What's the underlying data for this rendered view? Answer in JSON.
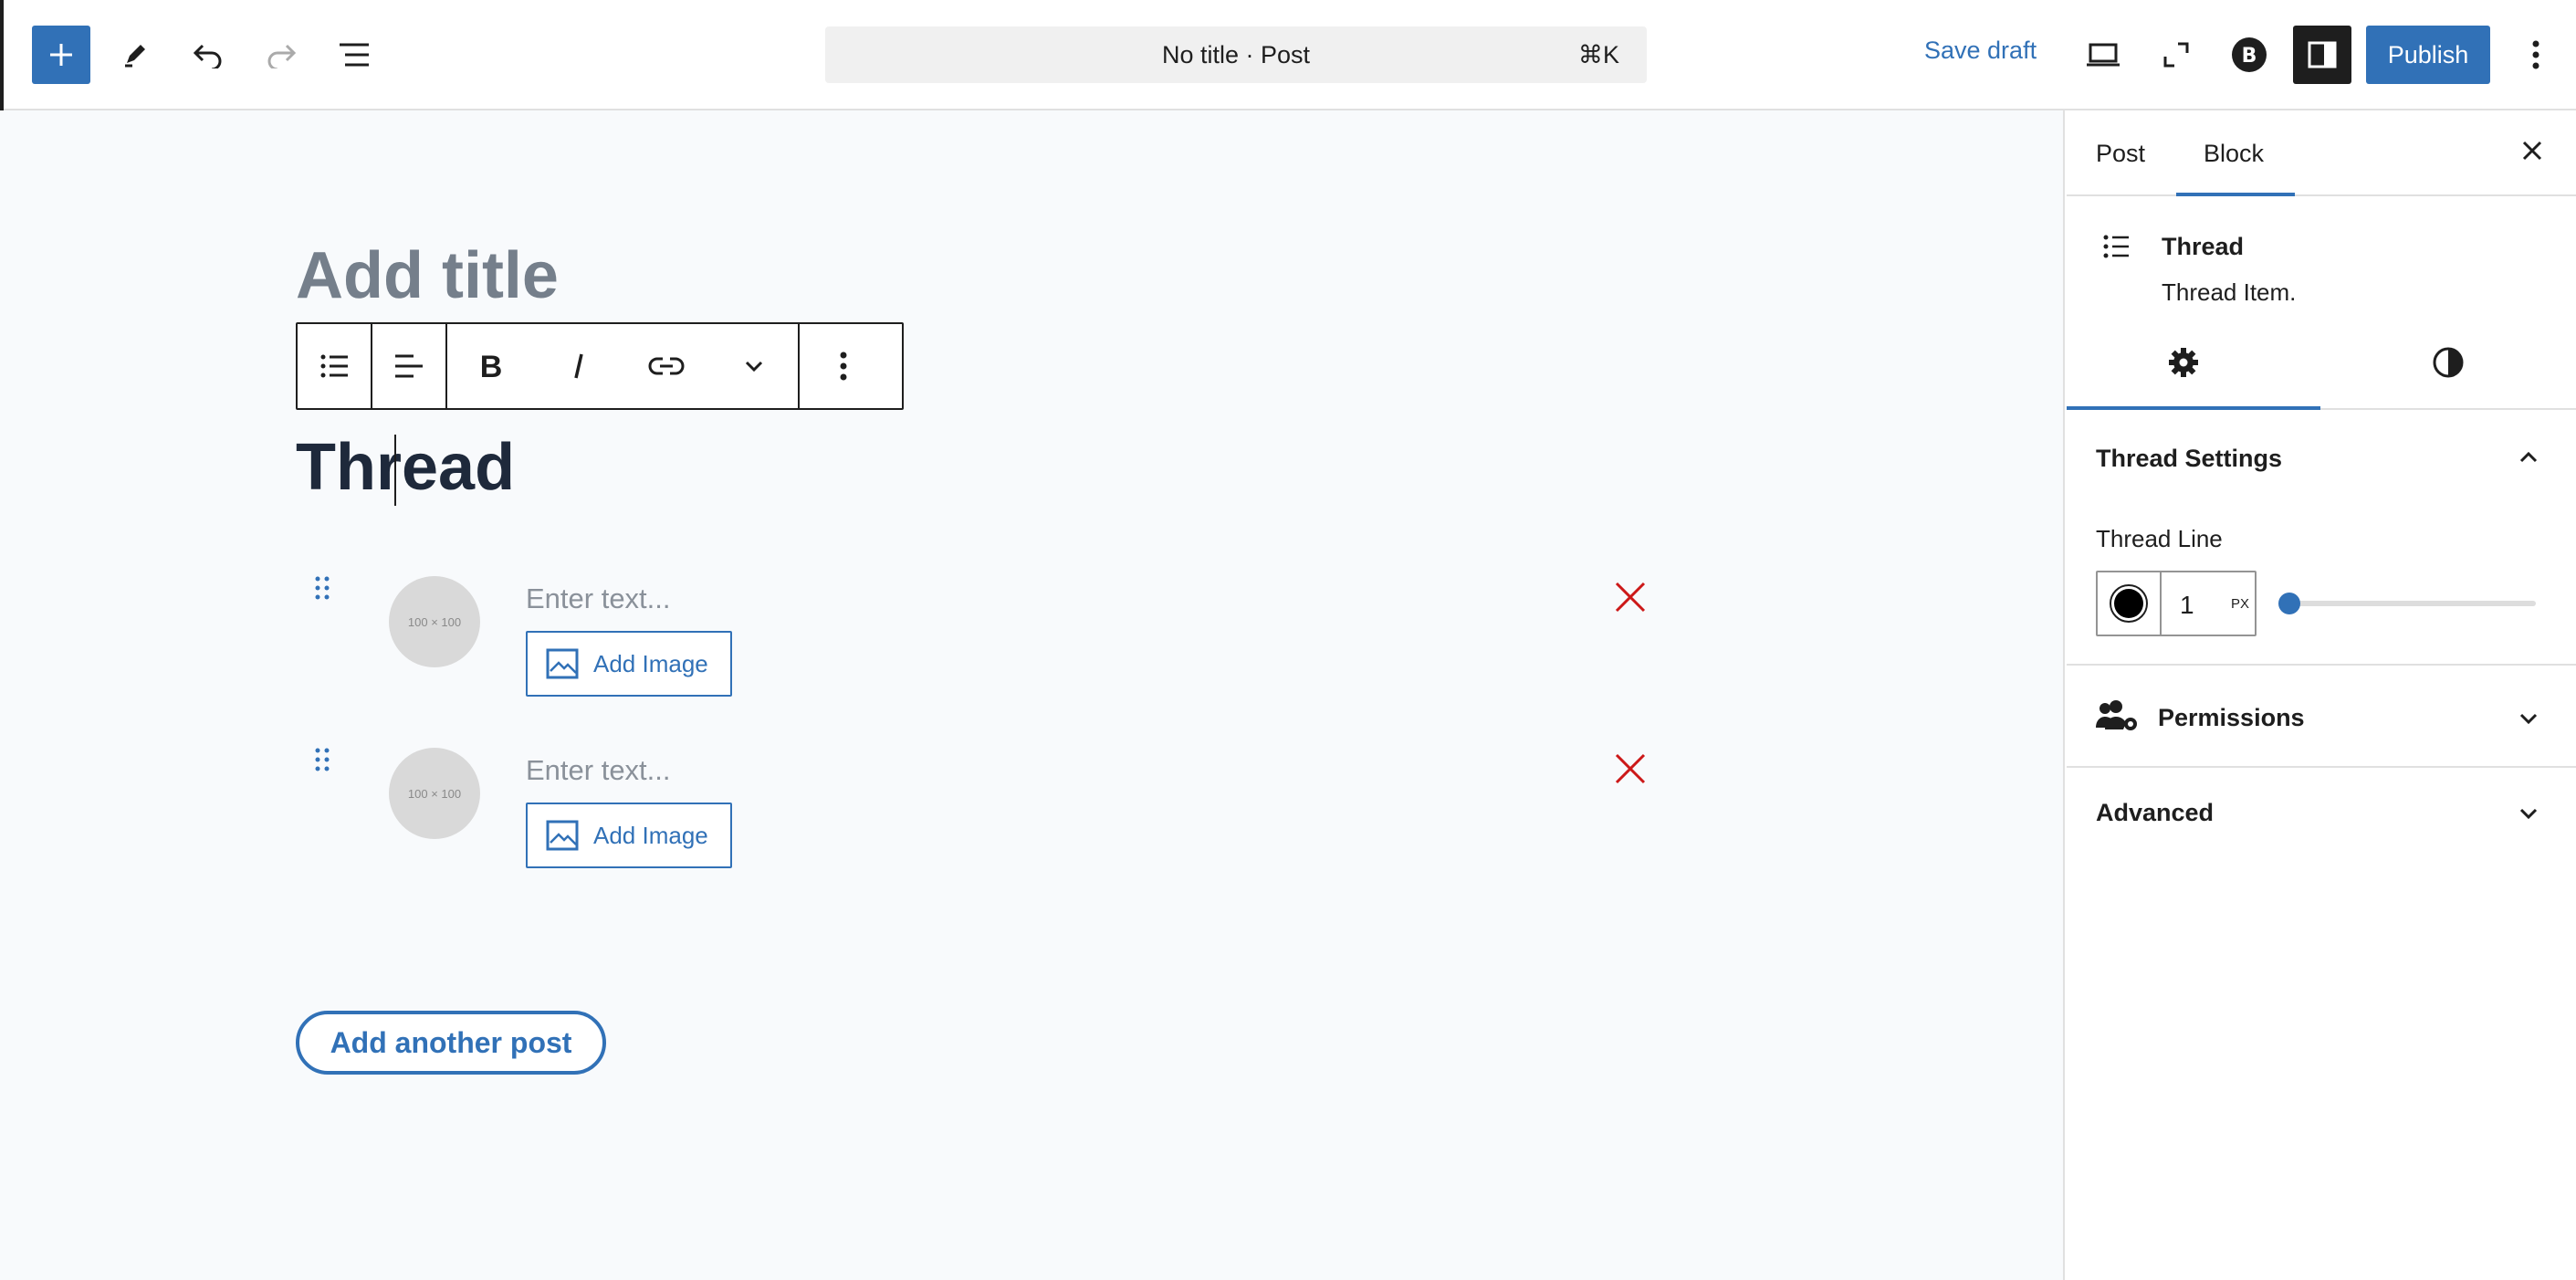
{
  "header": {
    "document_title": "No title · Post",
    "command_shortcut": "⌘K",
    "save_draft_label": "Save draft",
    "publish_label": "Publish",
    "icons": [
      "plus-icon",
      "pencil-icon",
      "undo-icon",
      "redo-icon",
      "list-view-icon",
      "desktop-preview-icon",
      "fullscreen-icon",
      "plugin-b-icon",
      "sidebar-toggle-icon",
      "more-vertical-icon"
    ]
  },
  "editor": {
    "title_placeholder": "Add title",
    "block_toolbar": [
      "list-icon",
      "align-left-icon",
      "bold-icon",
      "italic-icon",
      "link-icon",
      "chevron-down-icon",
      "more-vertical-icon"
    ],
    "heading_text": "Thread",
    "thread_items": [
      {
        "avatar_text": "100 × 100",
        "text_placeholder": "Enter text...",
        "add_image_label": "Add Image"
      },
      {
        "avatar_text": "100 × 100",
        "text_placeholder": "Enter text...",
        "add_image_label": "Add Image"
      }
    ],
    "add_post_label": "Add another post"
  },
  "sidebar": {
    "tabs": [
      "Post",
      "Block"
    ],
    "active_tab": "Block",
    "block_card": {
      "name": "Thread",
      "description": "Thread Item."
    },
    "settings_panel": {
      "title": "Thread Settings",
      "thread_line_label": "Thread Line",
      "width_value": "1",
      "width_unit": "PX"
    },
    "permissions_title": "Permissions",
    "advanced_title": "Advanced"
  },
  "colors": {
    "accent": "#3171b7",
    "remove": "#cc1818",
    "canvas_bg": "#f8fafc"
  }
}
